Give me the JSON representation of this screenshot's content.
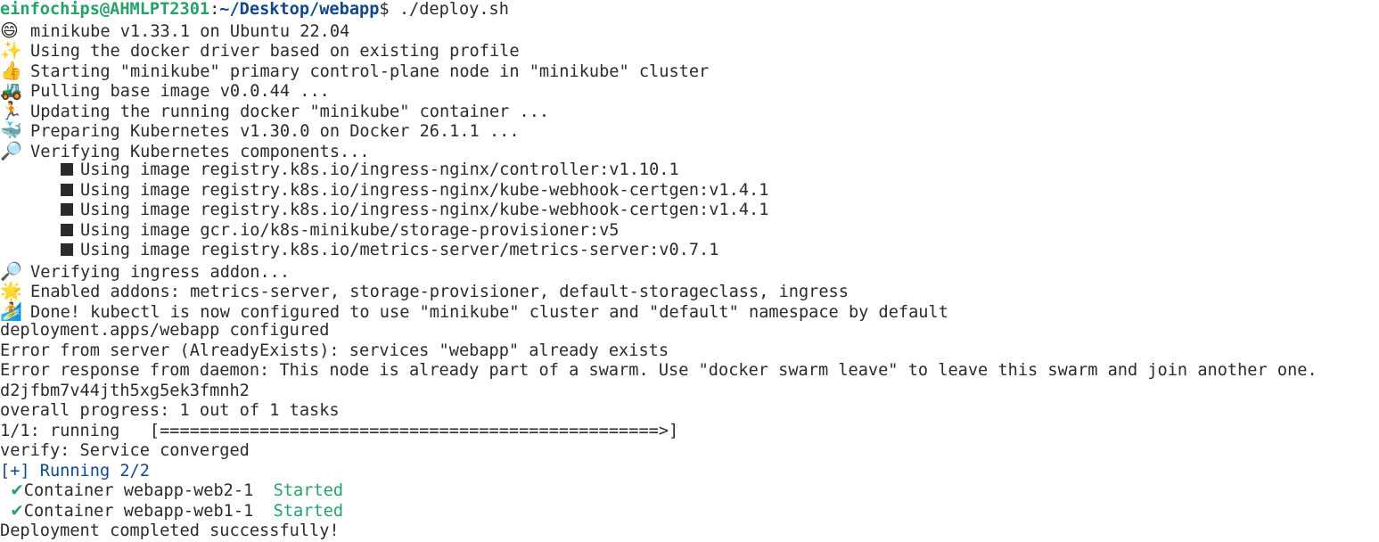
{
  "prompt": {
    "user_host": "einfochips@AHMLPT2301",
    "separator": ":",
    "path": "~/Desktop/webapp",
    "dollar": "$ ",
    "command": "./deploy.sh"
  },
  "minikube_lines": [
    {
      "icon": "grinning-face-icon",
      "glyph": "😄",
      "text": "minikube v1.33.1 on Ubuntu 22.04"
    },
    {
      "icon": "sparkles-icon",
      "glyph": "✨",
      "text": "Using the docker driver based on existing profile"
    },
    {
      "icon": "thumbs-up-icon",
      "glyph": "👍",
      "text": "Starting \"minikube\" primary control-plane node in \"minikube\" cluster"
    },
    {
      "icon": "tractor-icon",
      "glyph": "🚜",
      "text": "Pulling base image v0.0.44 ..."
    },
    {
      "icon": "runner-icon",
      "glyph": "🏃",
      "text": "Updating the running docker \"minikube\" container ..."
    },
    {
      "icon": "whale-icon",
      "glyph": "🐳",
      "text": "Preparing Kubernetes v1.30.0 on Docker 26.1.1 ..."
    },
    {
      "icon": "magnifier-icon",
      "glyph": "🔎",
      "text": "Verifying Kubernetes components..."
    }
  ],
  "images": [
    "Using image registry.k8s.io/ingress-nginx/controller:v1.10.1",
    "Using image registry.k8s.io/ingress-nginx/kube-webhook-certgen:v1.4.1",
    "Using image registry.k8s.io/ingress-nginx/kube-webhook-certgen:v1.4.1",
    "Using image gcr.io/k8s-minikube/storage-provisioner:v5",
    "Using image registry.k8s.io/metrics-server/metrics-server:v0.7.1"
  ],
  "minikube_lines_2": [
    {
      "icon": "magnifier-icon",
      "glyph": "🔎",
      "text": "Verifying ingress addon..."
    },
    {
      "icon": "star-icon",
      "glyph": "🌟",
      "text": "Enabled addons: metrics-server, storage-provisioner, default-storageclass, ingress"
    },
    {
      "icon": "surfer-icon",
      "glyph": "🏄",
      "text": "Done! kubectl is now configured to use \"minikube\" cluster and \"default\" namespace by default"
    }
  ],
  "plain_lines": [
    "deployment.apps/webapp configured",
    "Error from server (AlreadyExists): services \"webapp\" already exists",
    "Error response from daemon: This node is already part of a swarm. Use \"docker swarm leave\" to leave this swarm and join another one.",
    "d2jfbm7v44jth5xg5ek3fmnh2",
    "overall progress: 1 out of 1 tasks",
    "1/1: running   [==================================================>]",
    "verify: Service converged"
  ],
  "compose": {
    "running": "[+] Running 2/2",
    "containers": [
      {
        "name": "Container webapp-web2-1",
        "status": "Started"
      },
      {
        "name": "Container webapp-web1-1",
        "status": "Started"
      }
    ]
  },
  "final": "Deployment completed successfully!",
  "colors": {
    "prompt_user": "#26a269",
    "prompt_path": "#12488b",
    "running_blue": "#12488b",
    "started_green": "#26a269"
  }
}
